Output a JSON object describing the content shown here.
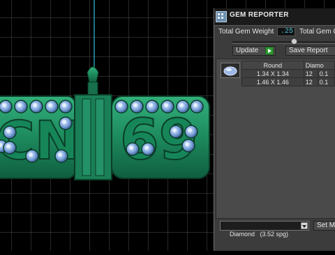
{
  "viewport": {
    "background": "#000000",
    "grid_color": "#5a5a5a",
    "model": {
      "text_left": "CN",
      "text_right": "69",
      "metal_color": "#1f8f63",
      "gem_color": "#8fb8e8",
      "wire_color": "#30c0d0"
    }
  },
  "reporter": {
    "title": "GEM REPORTER",
    "title_icon": "table-icon",
    "total_weight_label": "Total Gem Weight",
    "total_weight_value": ".25",
    "total_count_label": "Total Gem C",
    "update_label": "Update",
    "save_label": "Save Report",
    "table": {
      "headers": [
        "Round",
        "Diamo"
      ],
      "rows": [
        {
          "size": "1.34 X 1.34",
          "count": "12",
          "weight": "0.1"
        },
        {
          "size": "1.46 X 1.46",
          "count": "12",
          "weight": "0.1"
        }
      ]
    },
    "material_selected": "Diamond   (3.52 spg)",
    "set_button_label": "Set Ma"
  }
}
